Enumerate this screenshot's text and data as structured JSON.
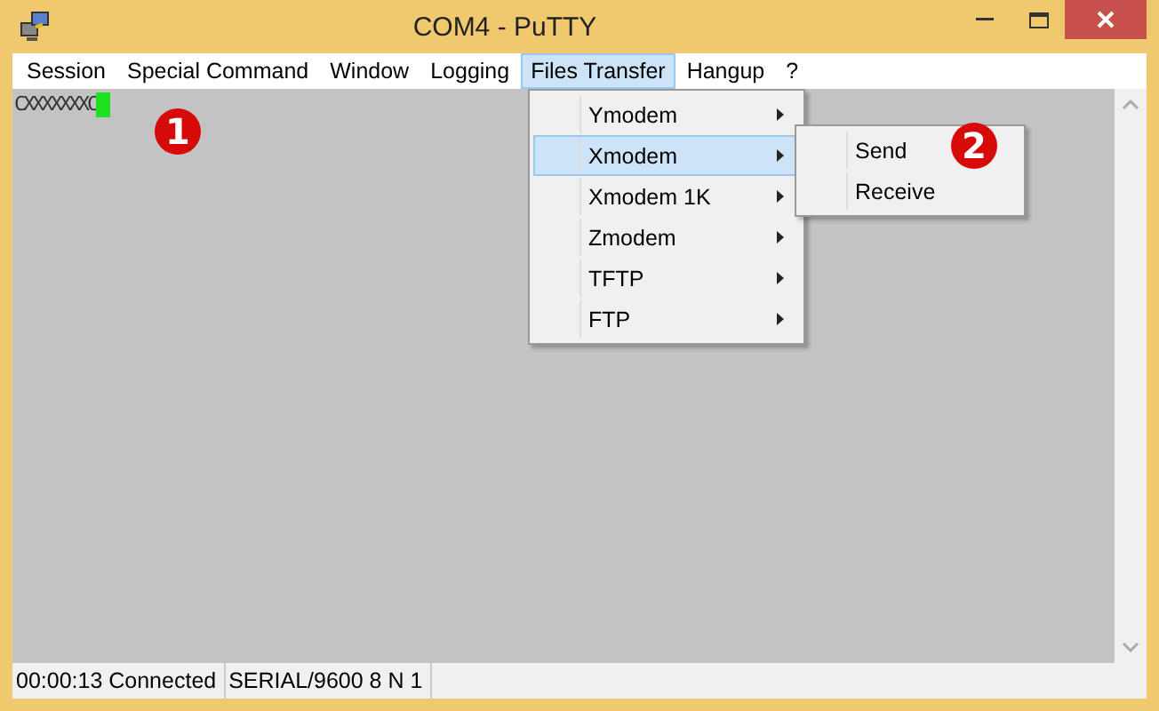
{
  "window": {
    "title": "COM4 - PuTTY"
  },
  "menu_bar": [
    {
      "label": "Session",
      "selected": false
    },
    {
      "label": "Special Command",
      "selected": false
    },
    {
      "label": "Window",
      "selected": false
    },
    {
      "label": "Logging",
      "selected": false
    },
    {
      "label": "Files Transfer",
      "selected": true
    },
    {
      "label": "Hangup",
      "selected": false
    },
    {
      "label": "?",
      "selected": false
    }
  ],
  "terminal": {
    "text": "CXXXXXXXC"
  },
  "dropdown": [
    {
      "label": "Ymodem",
      "selected": false
    },
    {
      "label": "Xmodem",
      "selected": true
    },
    {
      "label": "Xmodem 1K",
      "selected": false
    },
    {
      "label": "Zmodem",
      "selected": false
    },
    {
      "label": "TFTP",
      "selected": false
    },
    {
      "label": "FTP",
      "selected": false
    }
  ],
  "submenu": [
    {
      "label": "Send"
    },
    {
      "label": "Receive"
    }
  ],
  "callouts": [
    "1",
    "2"
  ],
  "status_bar": [
    "00:00:13 Connected",
    "SERIAL/9600 8 N 1"
  ]
}
